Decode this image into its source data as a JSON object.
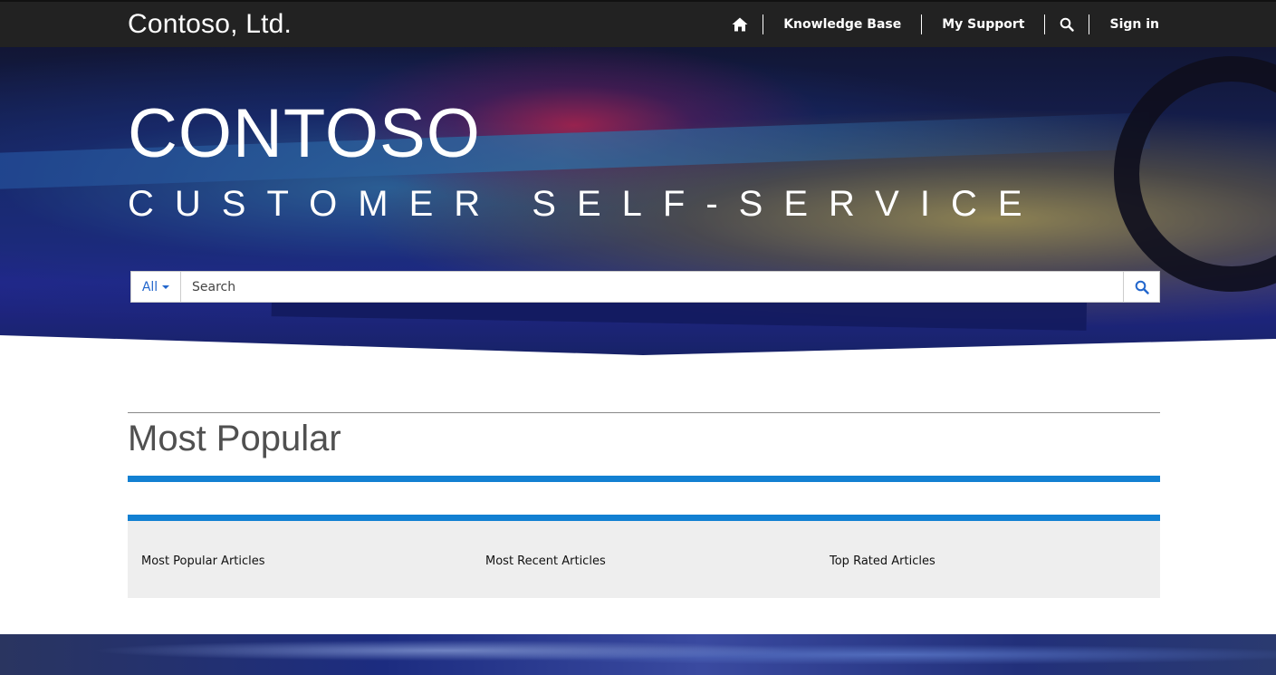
{
  "header": {
    "brand": "Contoso, Ltd.",
    "nav": [
      {
        "label": "",
        "icon": "home-icon"
      },
      {
        "label": "Knowledge Base"
      },
      {
        "label": "My Support"
      },
      {
        "label": "",
        "icon": "search-icon"
      },
      {
        "label": "Sign in"
      }
    ]
  },
  "hero": {
    "title": "CONTOSO",
    "subtitle": "CUSTOMER SELF-SERVICE"
  },
  "search": {
    "filter_label": "All",
    "placeholder": "Search",
    "button_icon": "search-icon"
  },
  "most_popular": {
    "title": "Most Popular",
    "columns": [
      {
        "label": "Most Popular Articles"
      },
      {
        "label": "Most Recent Articles"
      },
      {
        "label": "Top Rated Articles"
      }
    ]
  },
  "colors": {
    "topbar": "#222222",
    "accent": "#1280d2",
    "link": "#2266cc",
    "panel": "#eeeeee"
  }
}
